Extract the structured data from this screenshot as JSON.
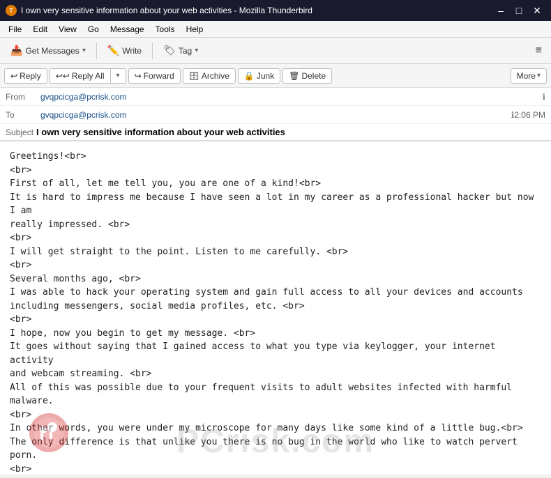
{
  "titlebar": {
    "title": "I own very sensitive information about your web activities - Mozilla Thunderbird",
    "icon": "T",
    "minimize": "–",
    "maximize": "□",
    "close": "✕"
  },
  "menubar": {
    "items": [
      "File",
      "Edit",
      "View",
      "Go",
      "Message",
      "Tools",
      "Help"
    ]
  },
  "toolbar": {
    "get_messages_label": "Get Messages",
    "write_label": "Write",
    "tag_label": "Tag",
    "menu_icon": "≡"
  },
  "action_bar": {
    "reply_label": "Reply",
    "reply_all_label": "Reply All",
    "forward_label": "Forward",
    "archive_label": "Archive",
    "junk_label": "Junk",
    "delete_label": "Delete",
    "more_label": "More"
  },
  "email": {
    "from_label": "From",
    "from_address": "gvqpcicga@pcrisk.com",
    "to_label": "To",
    "to_address": "gvqpcicga@pcrisk.com",
    "time": "2:06 PM",
    "subject_label": "Subject",
    "subject_text": "I own very sensitive information about your web activities",
    "body": "Greetings!<br>\n<br>\nFirst of all, let me tell you, you are one of a kind!<br>\nIt is hard to impress me because I have seen a lot in my career as a professional hacker but now I am\nreally impressed. <br>\n<br>\nI will get straight to the point. Listen to me carefully. <br>\n<br>\nSeveral months ago, <br>\nI was able to hack your operating system and gain full access to all your devices and accounts\nincluding messengers, social media profiles, etc. <br>\n<br>\nI hope, now you begin to get my message. <br>\nIt goes without saying that I gained access to what you type via keylogger, your internet activity\nand webcam streaming. <br>\nAll of this was possible due to your frequent visits to adult websites infected with harmful malware.\n<br>\nIn other words, you were under my microscope for many days like some kind of a little bug.<br>\nThe only difference is that unlike you there is no bug in the world who like to watch pervert porn.\n<br>\n<br>\nYes, you understand it right: I was able to see everything on your screen and record video and audio\nstreams of your camera and microphone. <br>\nAll of these records are currently securely saved on my storage as well as a backup copy. <br>\n<br>\nIn addition, I also gained access to your confidential information contained in your emails and chat\nmessages.<br>\n<br>\nIf you are wondering why your antivirus and spyware defender software allowed me to do all of\nthat: <br>\nY"
  },
  "watermark": {
    "text": "PCrisk.com"
  }
}
